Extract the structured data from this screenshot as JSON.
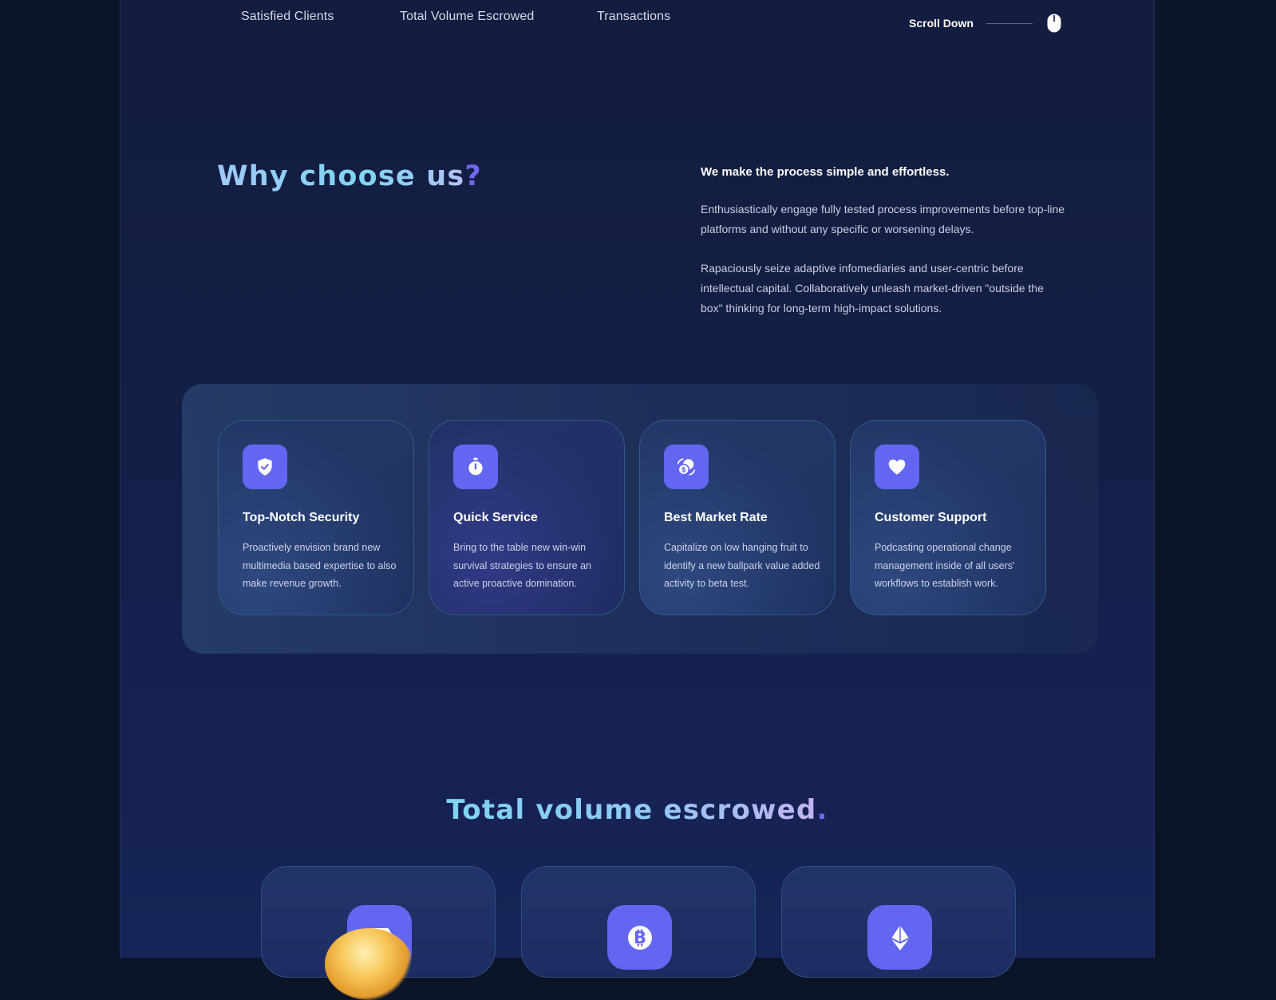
{
  "stats_nav": {
    "items": [
      "Satisfied Clients",
      "Total Volume Escrowed",
      "Transactions"
    ],
    "scroll_label": "Scroll Down"
  },
  "why": {
    "title_main": "Why choose us",
    "title_accent": "?",
    "lead": "We make the process simple and effortless.",
    "paragraphs": [
      "Enthusiastically engage fully tested process improvements before top-line platforms and without any specific or worsening delays.",
      "Rapaciously seize adaptive infomediaries and user-centric before intellectual capital. Collaboratively unleash market-driven \"outside the box\" thinking for long-term high-impact solutions."
    ]
  },
  "features": [
    {
      "icon": "shield-check-icon",
      "title": "Top-Notch Security",
      "desc": "Proactively envision brand new multimedia based expertise to also make revenue growth."
    },
    {
      "icon": "stopwatch-icon",
      "title": "Quick Service",
      "desc": "Bring to the table new win-win survival strategies to ensure an active proactive domination."
    },
    {
      "icon": "currency-exchange-icon",
      "title": "Best Market Rate",
      "desc": "Capitalize on low hanging fruit to identify a new ballpark value added activity to beta test."
    },
    {
      "icon": "heart-icon",
      "title": "Customer Support",
      "desc": "Podcasting operational change management inside of all users' workflows to establish work."
    }
  ],
  "volume": {
    "title_main": "Total volume escrowed",
    "title_accent": ".",
    "coins": [
      "tether-icon",
      "bitcoin-icon",
      "ethereum-icon"
    ]
  },
  "colors": {
    "accent": "#6366f1",
    "background": "#0b1527",
    "panel": "#131e44"
  }
}
